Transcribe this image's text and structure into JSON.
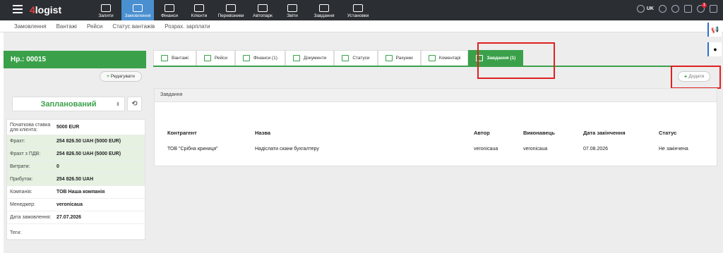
{
  "topbar": {
    "logo_num": "4",
    "logo_text": "logist",
    "nav": [
      {
        "label": "Запити",
        "icon": "chat-icon"
      },
      {
        "label": "Замовлення",
        "icon": "orders-icon",
        "active": true
      },
      {
        "label": "Фінанси",
        "icon": "money-icon"
      },
      {
        "label": "Клієнти",
        "icon": "clients-icon"
      },
      {
        "label": "Перевізники",
        "icon": "truck-icon"
      },
      {
        "label": "Автопарк",
        "icon": "garage-icon"
      },
      {
        "label": "Звіти",
        "icon": "reports-icon"
      },
      {
        "label": "Завдання",
        "icon": "calendar-icon"
      },
      {
        "label": "Установки",
        "icon": "gear-icon"
      }
    ],
    "lang": "UK",
    "notifications": "1"
  },
  "subnav": [
    "Замовлення",
    "Вантажі",
    "Рейси",
    "Статус вантажів",
    "Розрах. зарплати"
  ],
  "order": {
    "number": "Нр.: 00015",
    "edit_label": "Редагувати",
    "status": "Запланований",
    "info": [
      {
        "k": "Початкова ставка для клієнта:",
        "v": "5000 EUR",
        "green": false,
        "tall": true
      },
      {
        "k": "Фрахт:",
        "v": "254 826.50 UAH (5000 EUR)",
        "green": true
      },
      {
        "k": "Фрахт з ПДВ:",
        "v": "254 826.50 UAH (5000 EUR)",
        "green": true
      },
      {
        "k": "Витрати:",
        "v": "0",
        "green": true
      },
      {
        "k": "Прибуток:",
        "v": "254 826.50 UAH",
        "green": true
      },
      {
        "k": "Компанія:",
        "v": "ТОВ Наша компанія",
        "green": false
      },
      {
        "k": "Менеджер:",
        "v": "veronicaua",
        "green": false
      },
      {
        "k": "Дата замовлення:",
        "v": "27.07.2026",
        "green": false
      },
      {
        "k": "Теги:",
        "v": "",
        "green": false
      }
    ]
  },
  "tabs": [
    {
      "label": "Вантажі"
    },
    {
      "label": "Рейси"
    },
    {
      "label": "Фінанси (1)"
    },
    {
      "label": "Документи"
    },
    {
      "label": "Статуси"
    },
    {
      "label": "Рахунки"
    },
    {
      "label": "Коментарі"
    },
    {
      "label": "Завдання (1)",
      "active": true
    }
  ],
  "add_label": "Додати",
  "tasks": {
    "title": "Завдання",
    "headers": [
      "Контрагент",
      "Назва",
      "Автор",
      "Виконавець",
      "Дата закінчення",
      "Статус"
    ],
    "rows": [
      [
        "ТОВ \"Срібна криниця\"",
        "Надіслати скани бухгалтеру",
        "veronicaua",
        "veronicaua",
        "07.08.2026",
        "Не закінчена"
      ]
    ]
  },
  "colors": {
    "accent": "#3aa14a",
    "nav_active": "#4a8fd0",
    "highlight": "#e02020"
  }
}
